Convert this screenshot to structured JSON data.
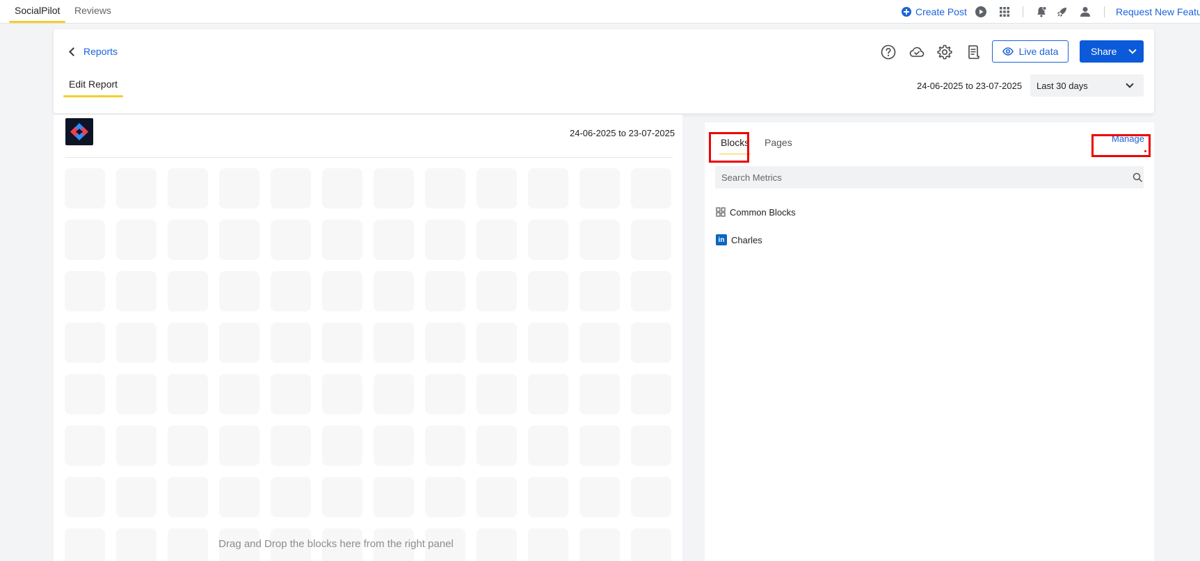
{
  "topnav": {
    "tabs": [
      {
        "label": "SocialPilot",
        "active": true
      },
      {
        "label": "Reviews",
        "active": false
      }
    ],
    "create_post": "Create Post",
    "request_feature": "Request New Feature",
    "icons": [
      "play-icon",
      "apps-grid-icon",
      "notifications-icon",
      "rocket-icon",
      "user-icon"
    ]
  },
  "header": {
    "back_label": "Reports",
    "edit_tab": "Edit Report",
    "icons": [
      "help-icon",
      "cloud-icon",
      "settings-icon",
      "document-icon"
    ],
    "live_data_label": "Live data",
    "share_label": "Share",
    "date_range": "24-06-2025 to 23-07-2025",
    "range_selected": "Last 30 days"
  },
  "canvas": {
    "date_range": "24-06-2025 to 23-07-2025",
    "drop_hint": "Drag and Drop the blocks here from the right panel"
  },
  "panel": {
    "tabs": [
      {
        "label": "Blocks",
        "active": true
      },
      {
        "label": "Pages",
        "active": false
      }
    ],
    "manage_label": "Manage",
    "search_placeholder": "Search Metrics",
    "groups": [
      {
        "label": "Common Blocks",
        "icon": "blocks-grid-icon"
      },
      {
        "label": "Charles",
        "icon": "linkedin-icon"
      }
    ]
  },
  "colors": {
    "accent": "#1b63d9",
    "primary_button": "#0b5ad9",
    "tab_underline": "#f5cd2d",
    "highlight_box": "#ee0000",
    "linkedin": "#0a66c2"
  }
}
